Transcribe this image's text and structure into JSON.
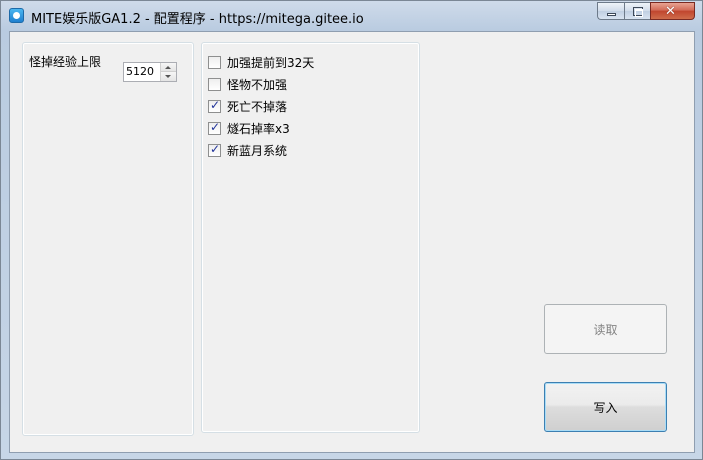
{
  "window": {
    "title": "MITE娱乐版GA1.2 - 配置程序 - https://mitega.gitee.io",
    "icon": "gear-app-icon",
    "caption_buttons": [
      "minimize",
      "maximize",
      "close"
    ]
  },
  "left_group": {
    "exp_limit_label": "怪掉经验上限",
    "exp_limit_value": "5120"
  },
  "options": [
    {
      "label": "加强提前到32天",
      "checked": false
    },
    {
      "label": "怪物不加强",
      "checked": false
    },
    {
      "label": "死亡不掉落",
      "checked": true
    },
    {
      "label": "燧石掉率x3",
      "checked": true
    },
    {
      "label": "新蓝月系统",
      "checked": true
    }
  ],
  "buttons": {
    "read_label": "读取",
    "write_label": "写入"
  }
}
